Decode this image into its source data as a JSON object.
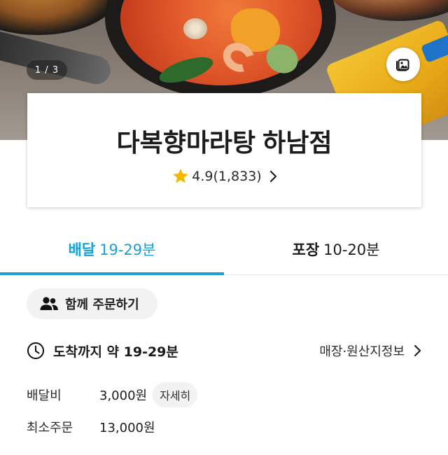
{
  "hero": {
    "counter": "1 / 3",
    "photo_button_icon": "photo-gallery-icon"
  },
  "store": {
    "name": "다복향마라탕 하남점",
    "rating": "4.9",
    "review_count": "(1,833)"
  },
  "tabs": [
    {
      "name": "배달",
      "time": "19-29분",
      "active": true
    },
    {
      "name": "포장",
      "time": "10-20분",
      "active": false
    }
  ],
  "group_order": {
    "label": "함께 주문하기"
  },
  "delivery_time": {
    "label": "도착까지 약 19-29분",
    "info_link": "매장·원산지정보"
  },
  "fees": [
    {
      "label": "배달비",
      "value": "3,000원",
      "detail": "자세히"
    },
    {
      "label": "최소주문",
      "value": "13,000원"
    }
  ],
  "colors": {
    "accent": "#1aa0d8",
    "star": "#f5b800",
    "text": "#1b1b1b",
    "chip_bg": "#f2f2f2"
  }
}
